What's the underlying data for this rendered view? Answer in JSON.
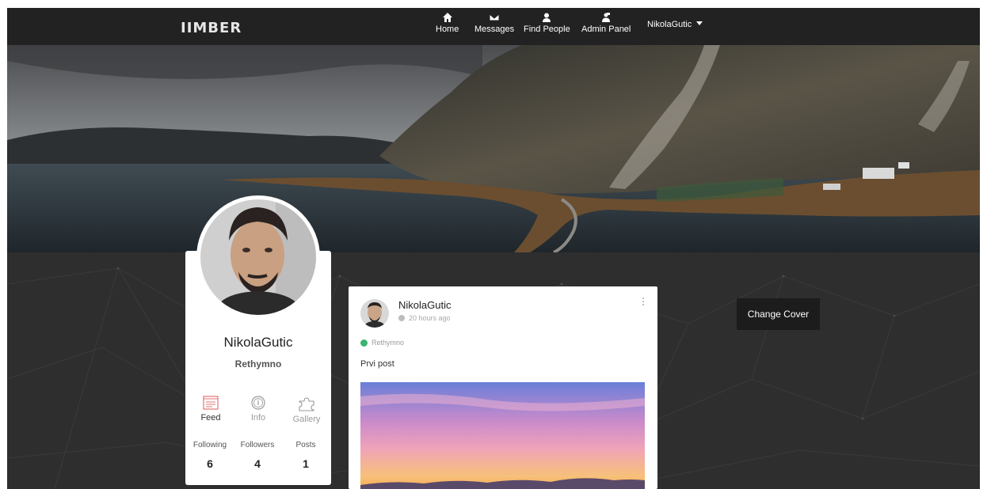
{
  "nav": {
    "logo": "IIMBER",
    "items": [
      {
        "label": "Home",
        "icon": "home-icon"
      },
      {
        "label": "Messages",
        "icon": "envelope-icon"
      },
      {
        "label": "Find People",
        "icon": "user-icon"
      },
      {
        "label": "Admin Panel",
        "icon": "admin-icon"
      }
    ],
    "user": "NikolaGutic"
  },
  "profile": {
    "name": "NikolaGutic",
    "location": "Rethymno",
    "tabs": [
      {
        "label": "Feed",
        "icon": "feed-icon",
        "active": true
      },
      {
        "label": "Info",
        "icon": "info-icon",
        "active": false
      },
      {
        "label": "Gallery",
        "icon": "puzzle-icon",
        "active": false
      }
    ],
    "stats": [
      {
        "label": "Following",
        "value": "6"
      },
      {
        "label": "Followers",
        "value": "4"
      },
      {
        "label": "Posts",
        "value": "1"
      }
    ]
  },
  "post": {
    "author": "NikolaGutic",
    "time": "20 hours ago",
    "location": "Rethymno",
    "text": "Prvi post"
  },
  "actions": {
    "change_cover": "Change Cover"
  },
  "colors": {
    "navbar": "#222222",
    "background": "#2e2e2e",
    "feed_accent": "#e57373",
    "location_check": "#3cb371"
  }
}
